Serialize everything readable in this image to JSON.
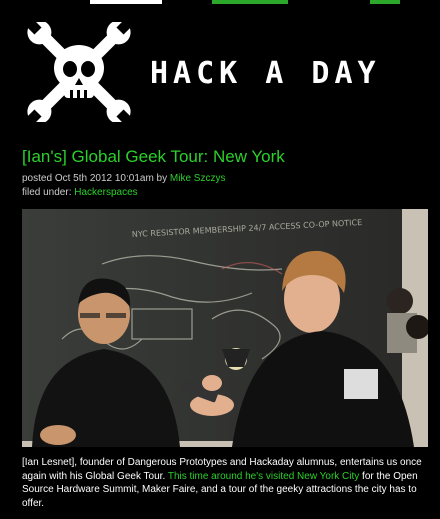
{
  "brand": {
    "name": "HACK A DAY",
    "logo_icon": "skull-wrenches-icon"
  },
  "post": {
    "title": "[Ian's] Global Geek Tour: New York",
    "posted_prefix": "posted ",
    "posted_date": "Oct 5th 2012 10:01am",
    "by": " by ",
    "author": "Mike Szczys",
    "filed_prefix": "filed under: ",
    "category": "Hackerspaces"
  },
  "photo": {
    "chalkboard_text": "NYC RESISTOR MEMBERSHIP 24/7 ACCESS CO-OP NOTICE"
  },
  "body": {
    "p1": "[Ian Lesnet], founder of Dangerous Prototypes and Hackaday alumnus, entertains us once again with his Global Geek Tour. ",
    "link": "This time around he's visited New York City",
    "p2": " for the Open Source Hardware Summit, Maker Faire, and a tour of the geeky attractions the city has to offer."
  },
  "colors": {
    "accent": "#2bd02b",
    "background": "#000000",
    "text": "#ffffff"
  }
}
